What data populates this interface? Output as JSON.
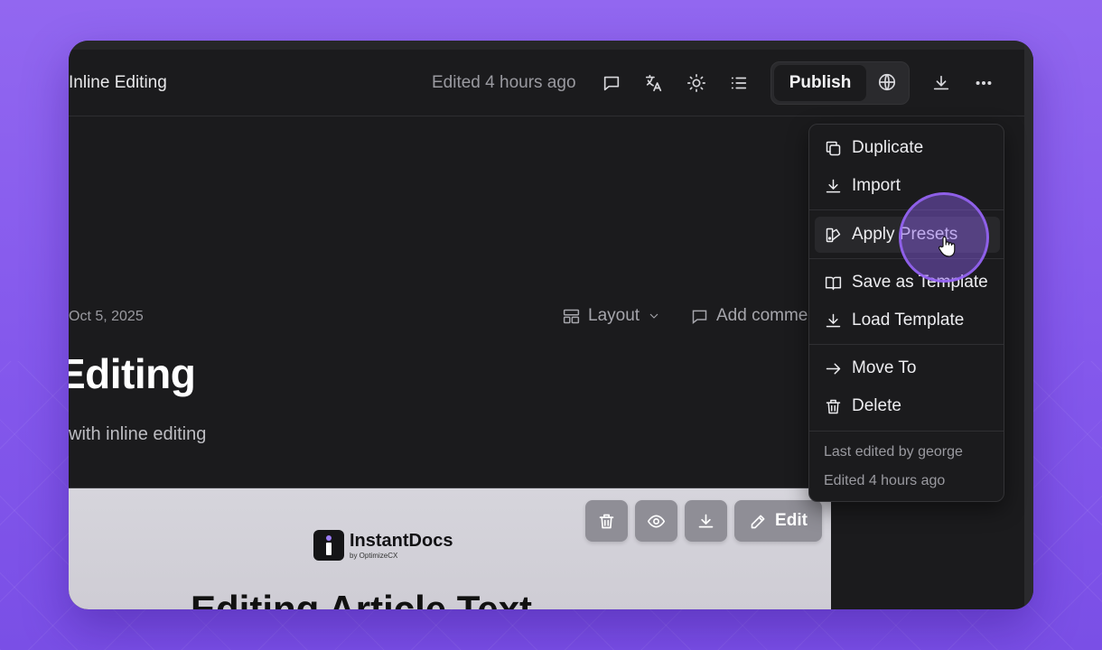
{
  "header": {
    "doc_title": "Inline Editing",
    "edited": "Edited 4 hours ago",
    "publish_label": "Publish"
  },
  "page": {
    "date": "Oct 5, 2025",
    "layout_label": "Layout",
    "comment_label": "Add comme",
    "title": "Editing",
    "subtitle": "with inline editing"
  },
  "preview": {
    "logo_name": "InstantDocs",
    "logo_sub": "by OptimizeCX",
    "heading": "Editing Article Text",
    "edit_label": "Edit"
  },
  "menu": {
    "items": [
      {
        "label": "Duplicate",
        "icon": "copy-icon"
      },
      {
        "label": "Import",
        "icon": "download-icon"
      },
      {
        "label": "Apply Presets",
        "icon": "swatch-icon"
      },
      {
        "label": "Save as Template",
        "icon": "book-icon"
      },
      {
        "label": "Load Template",
        "icon": "download-icon"
      },
      {
        "label": "Move To",
        "icon": "arrow-right-icon"
      },
      {
        "label": "Delete",
        "icon": "trash-icon"
      }
    ],
    "footer_by": "Last edited by george",
    "footer_time": "Edited 4 hours ago"
  },
  "colors": {
    "background": "#8a5eee",
    "window": "#1b1b1d",
    "accent": "#9b7cf5"
  }
}
